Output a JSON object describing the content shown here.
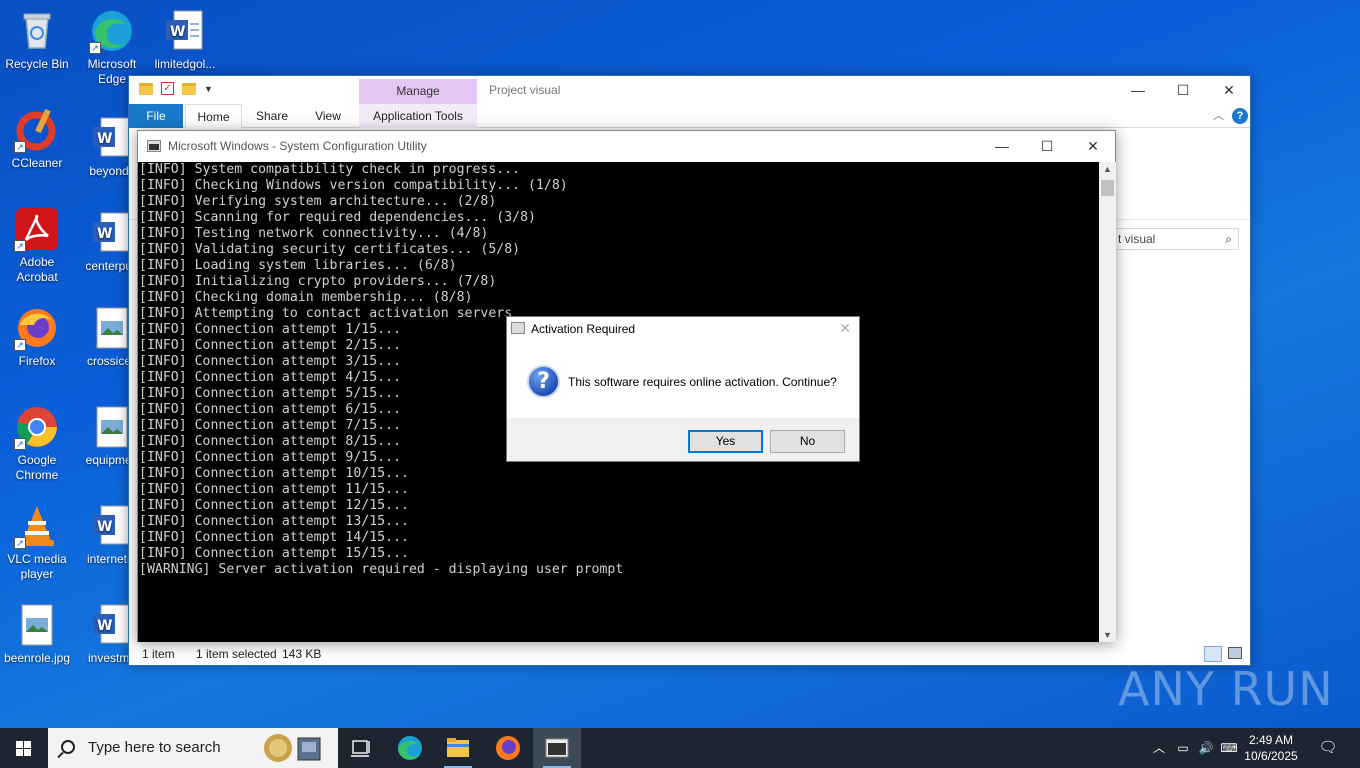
{
  "desktop": {
    "icons": [
      {
        "label": "Recycle Bin"
      },
      {
        "label": "Microsoft Edge"
      },
      {
        "label": "limitedgol..."
      },
      {
        "label": "CCleaner"
      },
      {
        "label": "beyondfl"
      },
      {
        "label": "Adobe Acrobat"
      },
      {
        "label": "centerpub"
      },
      {
        "label": "Firefox"
      },
      {
        "label": "crossice.j"
      },
      {
        "label": "Google Chrome"
      },
      {
        "label": "equipmen"
      },
      {
        "label": "VLC media player"
      },
      {
        "label": "internetm"
      },
      {
        "label": "beenrole.jpg"
      },
      {
        "label": "investme"
      }
    ]
  },
  "explorer": {
    "manage_label": "Manage",
    "title": "Project visual",
    "tabs": {
      "file": "File",
      "home": "Home",
      "share": "Share",
      "view": "View",
      "app_tools": "Application Tools"
    },
    "search_value": "t visual",
    "status": {
      "items": "1 item",
      "selected": "1 item selected",
      "size": "143 KB"
    }
  },
  "console": {
    "title": "Microsoft Windows - System Configuration Utility",
    "lines": [
      "[INFO] System compatibility check in progress...",
      "[INFO] Checking Windows version compatibility... (1/8)",
      "[INFO] Verifying system architecture... (2/8)",
      "[INFO] Scanning for required dependencies... (3/8)",
      "[INFO] Testing network connectivity... (4/8)",
      "[INFO] Validating security certificates... (5/8)",
      "[INFO] Loading system libraries... (6/8)",
      "[INFO] Initializing crypto providers... (7/8)",
      "[INFO] Checking domain membership... (8/8)",
      "[INFO] Attempting to contact activation servers",
      "[INFO] Connection attempt 1/15...",
      "[INFO] Connection attempt 2/15...",
      "[INFO] Connection attempt 3/15...",
      "[INFO] Connection attempt 4/15...",
      "[INFO] Connection attempt 5/15...",
      "[INFO] Connection attempt 6/15...",
      "[INFO] Connection attempt 7/15...",
      "[INFO] Connection attempt 8/15...",
      "[INFO] Connection attempt 9/15...",
      "[INFO] Connection attempt 10/15...",
      "[INFO] Connection attempt 11/15...",
      "[INFO] Connection attempt 12/15...",
      "[INFO] Connection attempt 13/15...",
      "[INFO] Connection attempt 14/15...",
      "[INFO] Connection attempt 15/15...",
      "[WARNING] Server activation required - displaying user prompt"
    ]
  },
  "dialog": {
    "title": "Activation Required",
    "message": "This software requires online activation. Continue?",
    "yes": "Yes",
    "no": "No"
  },
  "taskbar": {
    "search_placeholder": "Type here to search",
    "time": "2:49 AM",
    "date": "10/6/2025"
  },
  "watermark": "ANY RUN"
}
